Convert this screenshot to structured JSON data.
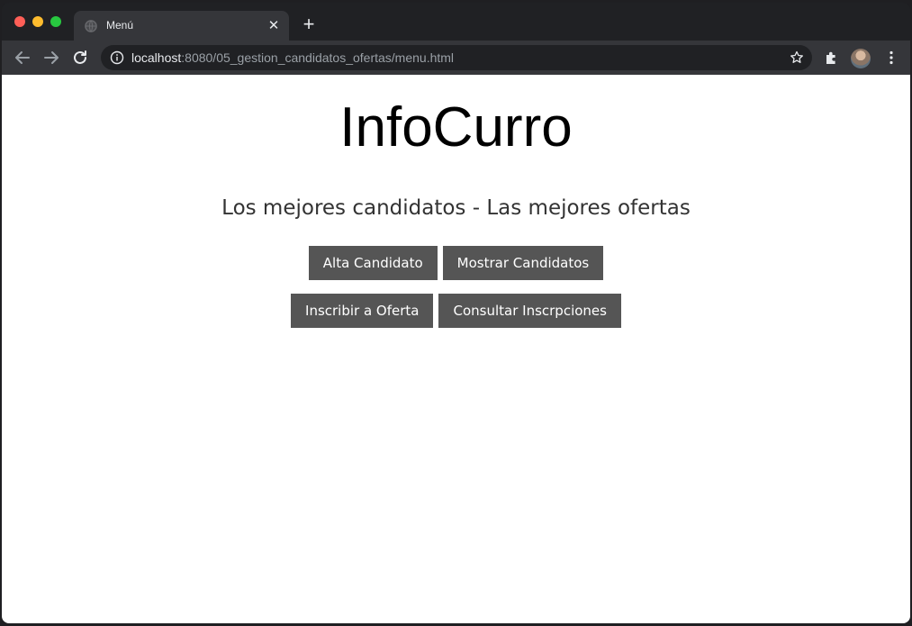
{
  "browser": {
    "tab_title": "Menú",
    "url_host": "localhost",
    "url_rest": ":8080/05_gestion_candidatos_ofertas/menu.html",
    "colors": {
      "traffic_red": "#ff5f57",
      "traffic_yellow": "#febc2e",
      "traffic_green": "#28c840"
    },
    "icons": [
      "close-icon",
      "new-tab-icon",
      "back-arrow-icon",
      "forward-arrow-icon",
      "reload-icon",
      "info-icon",
      "star-icon",
      "extensions-icon",
      "avatar",
      "menu-dots-icon"
    ]
  },
  "page": {
    "title": "InfoCurro",
    "tagline": "Los mejores candidatos - Las mejores ofertas",
    "buttons_row1": {
      "alta": "Alta Candidato",
      "mostrar": "Mostrar Candidatos"
    },
    "buttons_row2": {
      "inscribir": "Inscribir a Oferta",
      "consultar": "Consultar Inscrpciones"
    },
    "colors": {
      "button_bg": "#555555",
      "button_text": "#ffffff"
    }
  }
}
